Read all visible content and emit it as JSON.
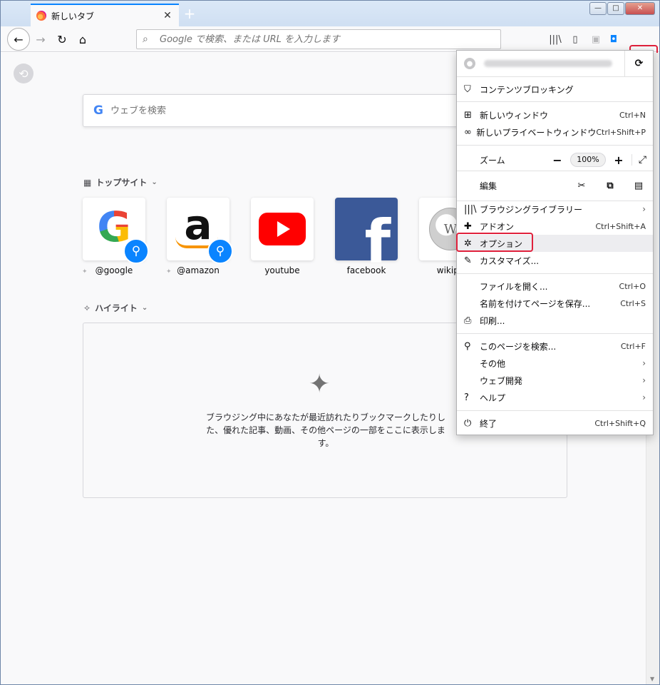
{
  "tab": {
    "title": "新しいタブ",
    "close": "✕",
    "new_tab": "+"
  },
  "window_controls": {
    "minimize": "—",
    "maximize": "□",
    "close": "✕"
  },
  "urlbar": {
    "placeholder": "Google で検索、または URL を入力します"
  },
  "websearch": {
    "placeholder": "ウェブを検索",
    "logo": "G"
  },
  "sections": {
    "topsites": "トップサイト",
    "highlights": "ハイライト"
  },
  "topsites": [
    {
      "label": "@google",
      "pinned": true,
      "search": true
    },
    {
      "label": "@amazon",
      "pinned": true,
      "search": true
    },
    {
      "label": "youtube",
      "pinned": false,
      "search": false
    },
    {
      "label": "facebook",
      "pinned": false,
      "search": false
    },
    {
      "label": "wikipe",
      "pinned": false,
      "search": false
    }
  ],
  "highlights_empty": "ブラウジング中にあなたが最近訪れたりブックマークしたりした、優れた記事、動画、その他ページの一部をここに表示します。",
  "menu": {
    "content_blocking": "コンテンツブロッキング",
    "new_window": {
      "label": "新しいウィンドウ",
      "shortcut": "Ctrl+N"
    },
    "new_private": {
      "label": "新しいプライベートウィンドウ",
      "shortcut": "Ctrl+Shift+P"
    },
    "zoom": {
      "label": "ズーム",
      "value": "100%",
      "minus": "−",
      "plus": "+"
    },
    "edit": {
      "label": "編集"
    },
    "library": {
      "label": "ブラウジングライブラリー"
    },
    "addons": {
      "label": "アドオン",
      "shortcut": "Ctrl+Shift+A"
    },
    "options": {
      "label": "オプション"
    },
    "customize": {
      "label": "カスタマイズ..."
    },
    "open_file": {
      "label": "ファイルを開く...",
      "shortcut": "Ctrl+O"
    },
    "save_page": {
      "label": "名前を付けてページを保存...",
      "shortcut": "Ctrl+S"
    },
    "print": {
      "label": "印刷..."
    },
    "find": {
      "label": "このページを検索...",
      "shortcut": "Ctrl+F"
    },
    "more": {
      "label": "その他"
    },
    "webdev": {
      "label": "ウェブ開発"
    },
    "help": {
      "label": "ヘルプ"
    },
    "quit": {
      "label": "終了",
      "shortcut": "Ctrl+Shift+Q"
    }
  },
  "colors": {
    "accent": "#0a84ff",
    "highlight_box": "#e0213c"
  }
}
